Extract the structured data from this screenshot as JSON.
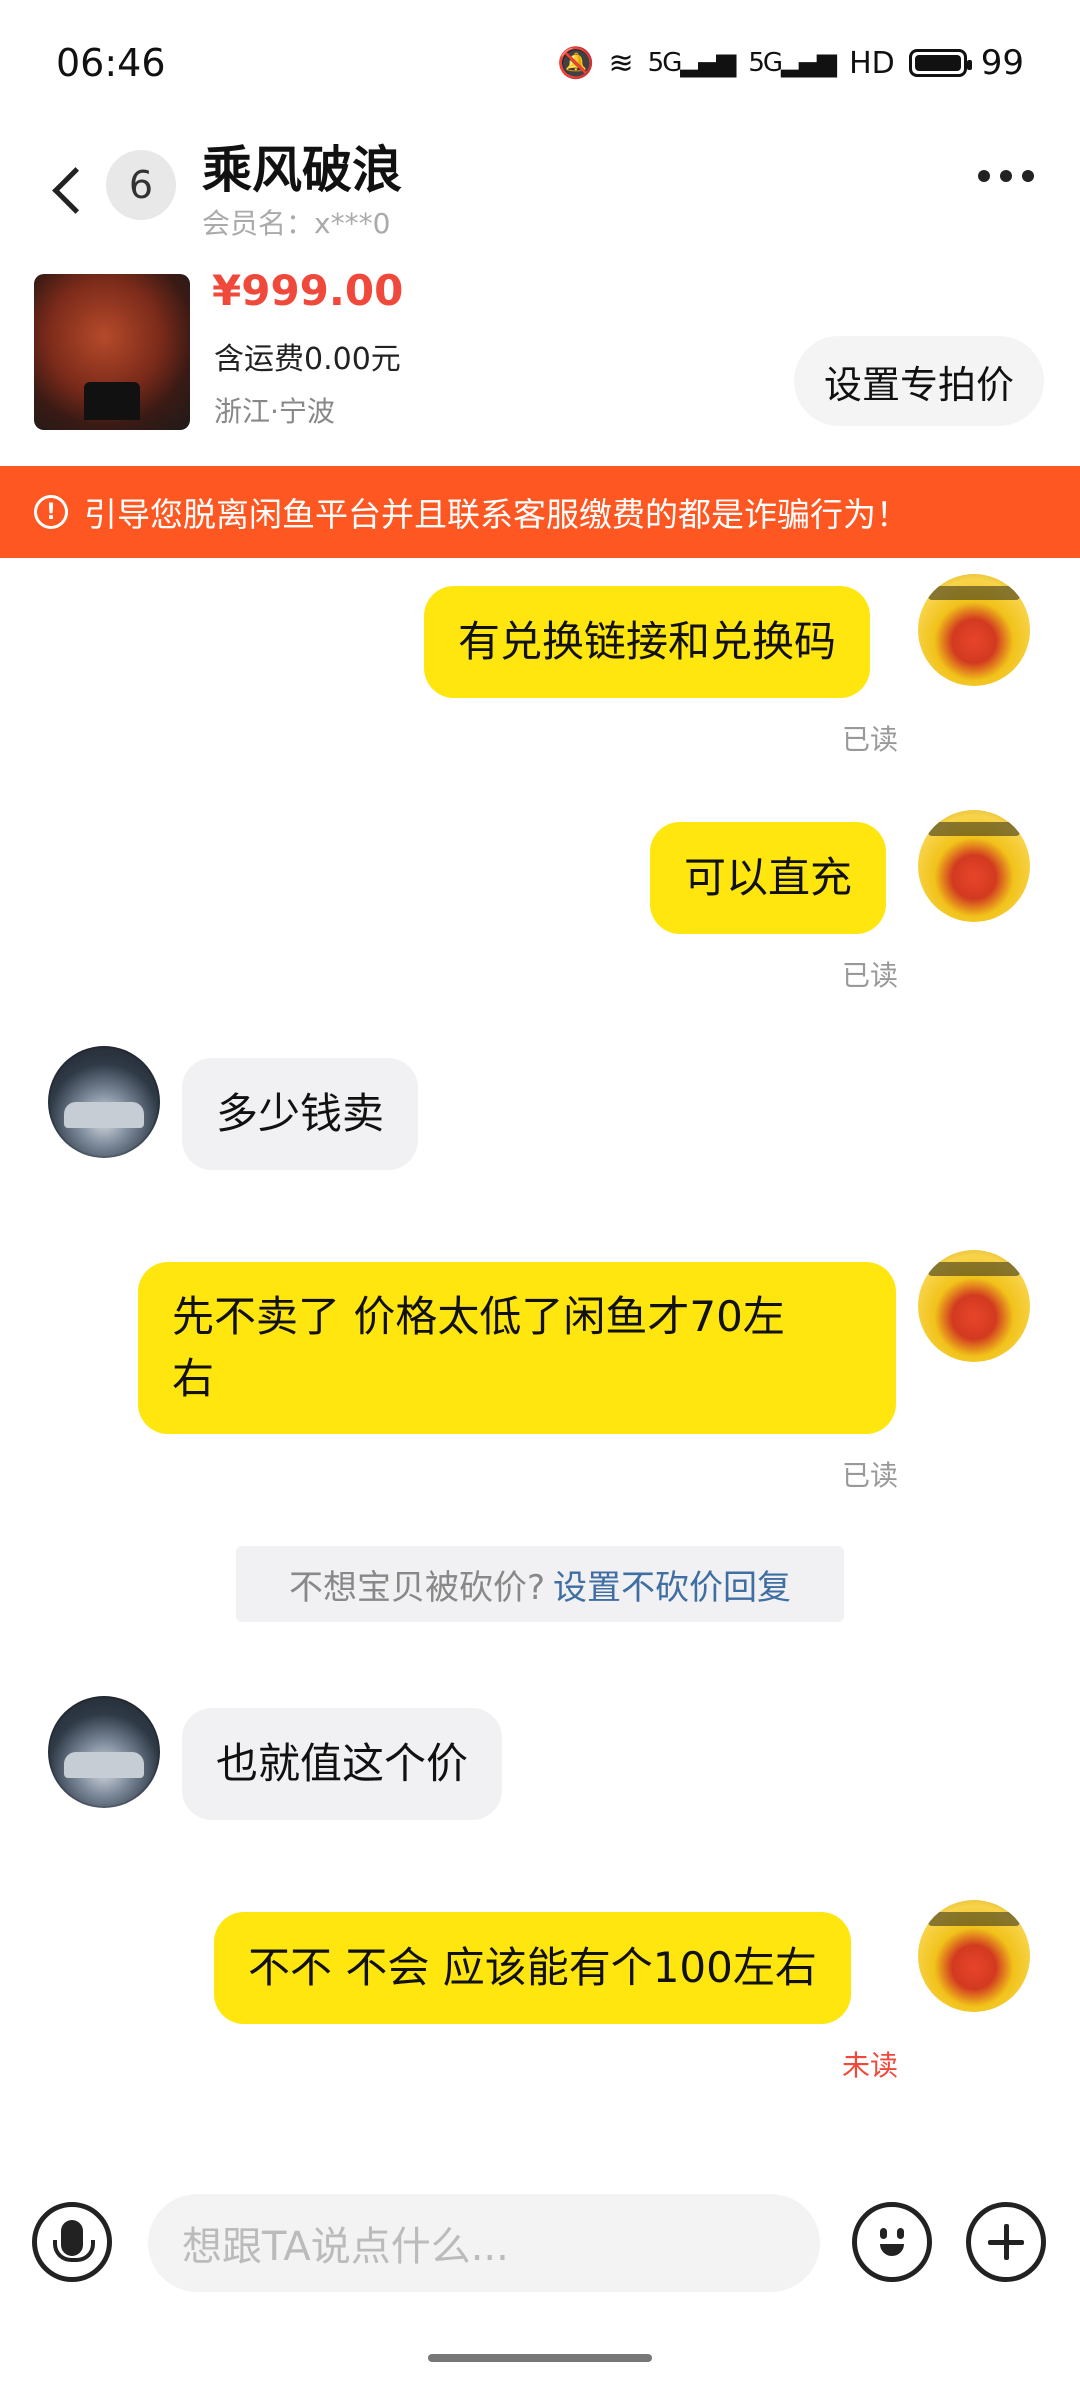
{
  "status_bar": {
    "time": "06:46",
    "network": "5G",
    "network2": "5G",
    "hd": "HD",
    "battery": "99"
  },
  "header": {
    "unread_count": "6",
    "contact_name": "乘风破浪",
    "member_label": "会员名：x***0"
  },
  "product": {
    "price": "¥999.00",
    "shipping": "含运费0.00元",
    "location": "浙江·宁波",
    "special_price_button": "设置专拍价"
  },
  "warning": {
    "icon": "!",
    "text": "引导您脱离闲鱼平台并且联系客服缴费的都是诈骗行为！"
  },
  "messages": [
    {
      "sender": "me",
      "text": "有兑换链接和兑换码",
      "status": "已读"
    },
    {
      "sender": "me",
      "text": "可以直充",
      "status": "已读"
    },
    {
      "sender": "other",
      "text": "多少钱卖"
    },
    {
      "sender": "me",
      "text_line1": "先不卖了  价格太低了闲鱼才70左",
      "text_line2": "右",
      "status": "已读"
    },
    {
      "sender": "other",
      "text": "也就值这个价"
    },
    {
      "sender": "me",
      "text": "不不  不会  应该能有个100左右",
      "status": "未读"
    }
  ],
  "system_tip": {
    "text": "不想宝贝被砍价?",
    "link": "设置不砍价回复"
  },
  "input": {
    "placeholder": "想跟TA说点什么..."
  }
}
